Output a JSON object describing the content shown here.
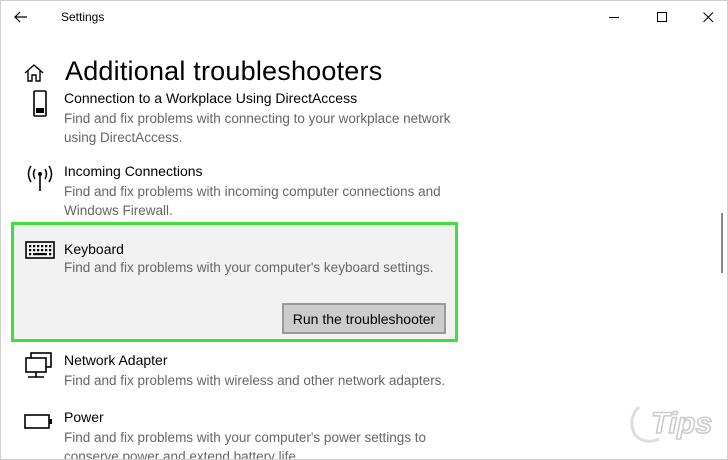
{
  "window": {
    "title": "Settings"
  },
  "page": {
    "title": "Additional troubleshooters"
  },
  "items": [
    {
      "name": "Connection to a Workplace Using DirectAccess",
      "description": "Find and fix problems with connecting to your workplace network using DirectAccess.",
      "icon": "phone-device-icon"
    },
    {
      "name": "Incoming Connections",
      "description": "Find and fix problems with incoming computer connections and Windows Firewall.",
      "icon": "antenna-icon"
    },
    {
      "name": "Keyboard",
      "description": "Find and fix problems with your computer's keyboard settings.",
      "icon": "keyboard-icon",
      "selected": true,
      "action_label": "Run the troubleshooter"
    },
    {
      "name": "Network Adapter",
      "description": "Find and fix problems with wireless and other network adapters.",
      "icon": "network-adapter-icon"
    },
    {
      "name": "Power",
      "description": "Find and fix problems with your computer's power settings to conserve power and extend battery life.",
      "icon": "battery-icon"
    }
  ],
  "colors": {
    "highlight_border": "#3fe03a",
    "selected_background": "#f2f2f2",
    "description_text": "#666666"
  },
  "watermark": {
    "text": "Tips",
    "icon": "tips-logo-icon"
  }
}
